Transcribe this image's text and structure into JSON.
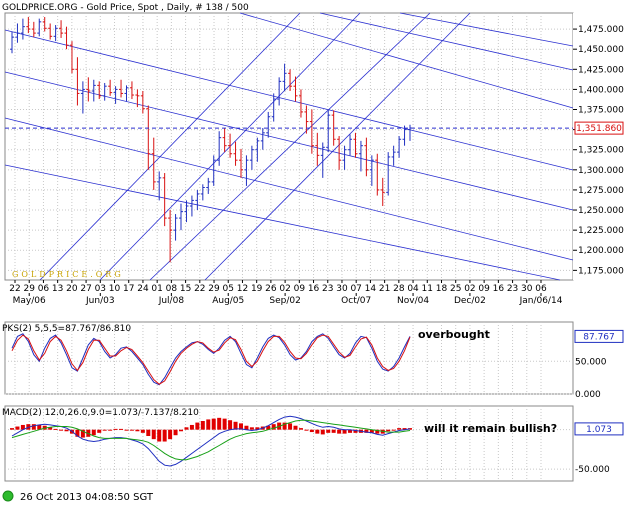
{
  "header": {
    "title": "GOLDPRICE.ORG - Gold Price, Spot , Daily, # 138 / 500"
  },
  "watermark": "GOLDPRICE.ORG",
  "colors": {
    "up": "#1f2fc0",
    "down": "#d81010",
    "channel": "#2a2fd0",
    "stoch_k": "#1f2fc0",
    "stoch_d": "#d81010",
    "macd_hist": "#e00000",
    "macd_line": "#1f2fc0",
    "macd_signal": "#17a017",
    "status_icon": "#2dbb2d"
  },
  "status": {
    "icon": "green-dot-icon",
    "timestamp": "26 Oct 2013 04:08:50 SGT"
  },
  "chart_data": [
    {
      "type": "candlestick",
      "title": "Gold Price, Spot, Daily",
      "ylim": [
        1163,
        1495
      ],
      "y_ticks": [
        1175,
        1200,
        1225,
        1250,
        1275,
        1300,
        1325,
        1350,
        1375,
        1400,
        1425,
        1450,
        1475
      ],
      "y_tick_labels": [
        "1,175.000",
        "1,200.000",
        "1,225.000",
        "1,250.000",
        "1,275.000",
        "1,300.000",
        "1,325.000",
        "1,350.000",
        "1,375.000",
        "1,400.000",
        "1,425.000",
        "1,450.000",
        "1,475.000"
      ],
      "x_day_labels": [
        "22",
        "29",
        "06",
        "13",
        "20",
        "27",
        "03",
        "10",
        "17",
        "24",
        "01",
        "08",
        "15",
        "22",
        "29",
        "05",
        "12",
        "19",
        "26",
        "02",
        "09",
        "16",
        "23",
        "30",
        "07",
        "14",
        "21",
        "28",
        "04",
        "11",
        "18",
        "25",
        "02",
        "09",
        "16",
        "23",
        "30",
        "06"
      ],
      "x_month_labels": [
        "May/06",
        "Jun/03",
        "Jul/08",
        "Aug/05",
        "Sep/02",
        "Oct/07",
        "Nov/04",
        "Dec/02",
        "Jan/06/14"
      ],
      "last_price_label": "1,351.860",
      "last_price": 1351.86,
      "series_ohlc_y_units": [
        [
          1450,
          1472,
          1445,
          1465
        ],
        [
          1465,
          1482,
          1458,
          1470
        ],
        [
          1470,
          1488,
          1462,
          1478
        ],
        [
          1478,
          1490,
          1470,
          1475
        ],
        [
          1475,
          1484,
          1465,
          1470
        ],
        [
          1470,
          1488,
          1466,
          1484
        ],
        [
          1484,
          1490,
          1472,
          1476
        ],
        [
          1476,
          1482,
          1462,
          1466
        ],
        [
          1466,
          1480,
          1460,
          1476
        ],
        [
          1476,
          1486,
          1464,
          1470
        ],
        [
          1470,
          1478,
          1450,
          1455
        ],
        [
          1455,
          1460,
          1420,
          1425
        ],
        [
          1425,
          1440,
          1380,
          1395
        ],
        [
          1395,
          1410,
          1370,
          1400
        ],
        [
          1400,
          1415,
          1385,
          1398
        ],
        [
          1398,
          1412,
          1385,
          1405
        ],
        [
          1405,
          1410,
          1388,
          1392
        ],
        [
          1392,
          1408,
          1386,
          1404
        ],
        [
          1404,
          1412,
          1392,
          1396
        ],
        [
          1396,
          1404,
          1382,
          1400
        ],
        [
          1400,
          1412,
          1390,
          1395
        ],
        [
          1395,
          1405,
          1385,
          1402
        ],
        [
          1402,
          1410,
          1388,
          1393
        ],
        [
          1393,
          1400,
          1378,
          1392
        ],
        [
          1392,
          1398,
          1370,
          1376
        ],
        [
          1376,
          1380,
          1300,
          1320
        ],
        [
          1320,
          1340,
          1275,
          1285
        ],
        [
          1285,
          1298,
          1262,
          1290
        ],
        [
          1290,
          1296,
          1230,
          1240
        ],
        [
          1240,
          1250,
          1185,
          1225
        ],
        [
          1225,
          1245,
          1212,
          1240
        ],
        [
          1240,
          1258,
          1225,
          1248
        ],
        [
          1248,
          1262,
          1235,
          1255
        ],
        [
          1255,
          1268,
          1242,
          1262
        ],
        [
          1262,
          1275,
          1250,
          1270
        ],
        [
          1270,
          1282,
          1262,
          1278
        ],
        [
          1278,
          1290,
          1270,
          1285
        ],
        [
          1285,
          1318,
          1280,
          1312
        ],
        [
          1312,
          1348,
          1305,
          1340
        ],
        [
          1340,
          1352,
          1322,
          1330
        ],
        [
          1330,
          1345,
          1315,
          1320
        ],
        [
          1320,
          1335,
          1305,
          1312
        ],
        [
          1312,
          1326,
          1290,
          1300
        ],
        [
          1300,
          1318,
          1280,
          1312
        ],
        [
          1312,
          1330,
          1300,
          1325
        ],
        [
          1325,
          1340,
          1310,
          1336
        ],
        [
          1336,
          1352,
          1325,
          1346
        ],
        [
          1346,
          1372,
          1340,
          1366
        ],
        [
          1366,
          1395,
          1360,
          1388
        ],
        [
          1388,
          1415,
          1380,
          1410
        ],
        [
          1410,
          1432,
          1398,
          1420
        ],
        [
          1420,
          1425,
          1398,
          1404
        ],
        [
          1404,
          1416,
          1385,
          1392
        ],
        [
          1392,
          1400,
          1365,
          1372
        ],
        [
          1372,
          1380,
          1345,
          1360
        ],
        [
          1360,
          1375,
          1320,
          1330
        ],
        [
          1330,
          1346,
          1305,
          1318
        ],
        [
          1318,
          1334,
          1290,
          1328
        ],
        [
          1328,
          1375,
          1322,
          1368
        ],
        [
          1368,
          1374,
          1330,
          1338
        ],
        [
          1338,
          1342,
          1300,
          1312
        ],
        [
          1312,
          1330,
          1300,
          1325
        ],
        [
          1325,
          1344,
          1318,
          1338
        ],
        [
          1338,
          1346,
          1315,
          1320
        ],
        [
          1320,
          1336,
          1298,
          1330
        ],
        [
          1330,
          1340,
          1292,
          1300
        ],
        [
          1300,
          1318,
          1280,
          1312
        ],
        [
          1312,
          1320,
          1268,
          1275
        ],
        [
          1275,
          1290,
          1255,
          1272
        ],
        [
          1272,
          1322,
          1268,
          1316
        ],
        [
          1316,
          1330,
          1305,
          1322
        ],
        [
          1322,
          1342,
          1315,
          1338
        ],
        [
          1338,
          1355,
          1330,
          1350
        ],
        [
          1350,
          1356,
          1336,
          1352
        ]
      ]
    },
    {
      "type": "line",
      "title": "PKS(2) 5,5,5=87.767/86.810",
      "ylim": [
        0,
        110
      ],
      "y_ticks": [
        0,
        50
      ],
      "y_tick_labels": [
        "0.000",
        "50.000"
      ],
      "last_value_label": "87.767",
      "series": [
        {
          "name": "K",
          "values": [
            70,
            88,
            92,
            80,
            60,
            50,
            70,
            85,
            90,
            78,
            60,
            40,
            35,
            55,
            75,
            85,
            80,
            65,
            55,
            60,
            70,
            72,
            65,
            55,
            45,
            30,
            18,
            14,
            25,
            40,
            55,
            65,
            72,
            78,
            80,
            76,
            68,
            62,
            70,
            82,
            88,
            80,
            62,
            45,
            40,
            55,
            72,
            85,
            90,
            86,
            75,
            60,
            52,
            55,
            65,
            80,
            88,
            92,
            85,
            72,
            60,
            55,
            62,
            78,
            88,
            86,
            70,
            50,
            38,
            35,
            42,
            55,
            72,
            88
          ]
        },
        {
          "name": "D",
          "values": [
            66,
            82,
            90,
            84,
            66,
            52,
            62,
            80,
            88,
            82,
            66,
            46,
            36,
            48,
            68,
            82,
            82,
            70,
            58,
            58,
            66,
            71,
            68,
            58,
            48,
            35,
            22,
            15,
            20,
            34,
            50,
            62,
            70,
            76,
            80,
            78,
            70,
            64,
            67,
            78,
            86,
            83,
            68,
            50,
            42,
            50,
            66,
            80,
            88,
            88,
            79,
            65,
            55,
            54,
            62,
            75,
            86,
            90,
            88,
            76,
            64,
            56,
            59,
            72,
            84,
            87,
            75,
            55,
            42,
            36,
            39,
            50,
            66,
            87
          ]
        }
      ]
    },
    {
      "type": "bar",
      "title": "MACD(2) 12.0,26.0,9.0=1.073/-7.137/8.210",
      "ylim": [
        -65,
        30
      ],
      "y_ticks": [
        -50
      ],
      "y_tick_labels": [
        "-50.000"
      ],
      "last_value_label": "1.073",
      "series": [
        {
          "name": "MACD",
          "values": [
            -8,
            -4,
            0,
            3,
            5,
            6,
            7,
            6,
            5,
            4,
            2,
            -2,
            -8,
            -12,
            -14,
            -15,
            -14,
            -12,
            -11,
            -10,
            -10,
            -11,
            -13,
            -15,
            -18,
            -24,
            -32,
            -40,
            -45,
            -46,
            -44,
            -40,
            -35,
            -30,
            -25,
            -20,
            -15,
            -10,
            -5,
            -2,
            0,
            1,
            1,
            0,
            -1,
            0,
            2,
            5,
            9,
            13,
            16,
            17,
            16,
            14,
            11,
            8,
            5,
            3,
            4,
            3,
            1,
            0,
            0,
            -1,
            -2,
            -3,
            -4,
            -6,
            -7,
            -5,
            -3,
            -1,
            0,
            1
          ]
        },
        {
          "name": "Signal",
          "values": [
            -10,
            -8,
            -6,
            -4,
            -2,
            0,
            2,
            3,
            4,
            4,
            4,
            3,
            1,
            -2,
            -5,
            -8,
            -10,
            -11,
            -11,
            -11,
            -11,
            -11,
            -12,
            -13,
            -14,
            -16,
            -20,
            -25,
            -30,
            -34,
            -37,
            -38,
            -38,
            -36,
            -34,
            -31,
            -28,
            -24,
            -20,
            -16,
            -12,
            -9,
            -7,
            -5,
            -4,
            -3,
            -2,
            0,
            2,
            4,
            7,
            9,
            11,
            12,
            12,
            11,
            10,
            9,
            8,
            7,
            6,
            5,
            4,
            3,
            2,
            1,
            0,
            -1,
            -2,
            -3,
            -3,
            -3,
            -2,
            -1
          ]
        },
        {
          "name": "Histogram",
          "values": [
            2,
            4,
            6,
            7,
            7,
            6,
            5,
            3,
            1,
            0,
            -2,
            -5,
            -9,
            -10,
            -9,
            -7,
            -4,
            -1,
            0,
            1,
            1,
            0,
            -1,
            -2,
            -4,
            -8,
            -12,
            -15,
            -15,
            -12,
            -7,
            -2,
            3,
            6,
            9,
            11,
            13,
            14,
            15,
            14,
            12,
            10,
            8,
            5,
            3,
            3,
            4,
            5,
            7,
            9,
            9,
            8,
            5,
            2,
            -1,
            -3,
            -5,
            -6,
            -4,
            -4,
            -5,
            -5,
            -4,
            -4,
            -4,
            -4,
            -4,
            -5,
            -5,
            -2,
            0,
            2,
            2,
            2
          ]
        }
      ]
    }
  ],
  "annotations": {
    "stoch_note": "overbought",
    "macd_note": "will it remain bullish?"
  }
}
